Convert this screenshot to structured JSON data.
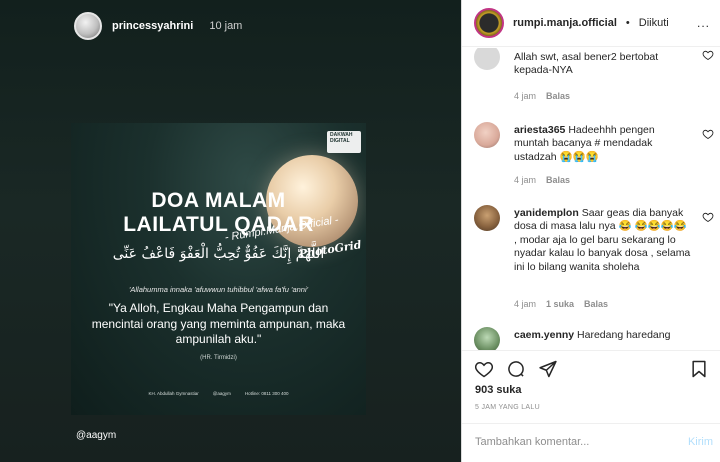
{
  "story": {
    "username": "princessyahrini",
    "time": "10 jam",
    "handle": "@aagym"
  },
  "poster": {
    "badge_line1": "DAKWAH",
    "badge_line2": "DIGITAL",
    "title_line1": "DOA MALAM",
    "title_line2": "LAILATUL QADAR",
    "arabic": "اللَّهُمَّ إِنَّكَ عَفُوٌّ تُحِبُّ الْعَفْوَ فَاعْفُ عَنِّى",
    "transliteration": "'Allahumma innaka 'afuwwun tuhibbul 'afwa fa'fu 'anni'",
    "meaning": "\"Ya Alloh, Engkau Maha Pengampun dan mencintai orang yang meminta ampunan, maka ampunilah aku.\"",
    "source": "(HR. Tirmidzi)",
    "footer_name": "KH. Abdullah Gymnastiar",
    "footer_ig": "@aagym",
    "footer_phone": "Hotline: 0811 300 400",
    "watermark": "- Rumpi.Manja.Official -",
    "watermark_app": "PhotoGrid"
  },
  "header": {
    "username": "rumpi.manja.official",
    "dot": "•",
    "follow_status": "Diikuti",
    "more": "..."
  },
  "comments": [
    {
      "username": "",
      "text": "Allah swt, asal bener2 bertobat kepada-NYA",
      "time": "4 jam",
      "reply": "Balas",
      "likes": ""
    },
    {
      "username": "ariesta365",
      "text": "Hadeehhh pengen muntah bacanya # mendadak ustadzah 😭😭😭",
      "time": "4 jam",
      "reply": "Balas",
      "likes": ""
    },
    {
      "username": "yanidemplon",
      "text": "Saar geas dia banyak dosa di masa lalu nya 😂 😂😂😂😂 , modar aja lo gel baru sekarang lo nyadar kalau lo banyak dosa , selama ini lo bilang wanita sholeha",
      "time": "4 jam",
      "reply": "Balas",
      "likes": "1 suka"
    },
    {
      "username": "caem.yenny",
      "text": "Haredang haredang",
      "time": "",
      "reply": "",
      "likes": ""
    }
  ],
  "likes_count": "903 suka",
  "time_ago": "5 JAM YANG LALU",
  "add_comment": {
    "placeholder": "Tambahkan komentar...",
    "post_label": "Kirim"
  },
  "colors": {
    "text": "#262626",
    "muted": "#8e8e8e",
    "link_disabled": "#b2dffc",
    "story_bg": "#1a2825"
  }
}
